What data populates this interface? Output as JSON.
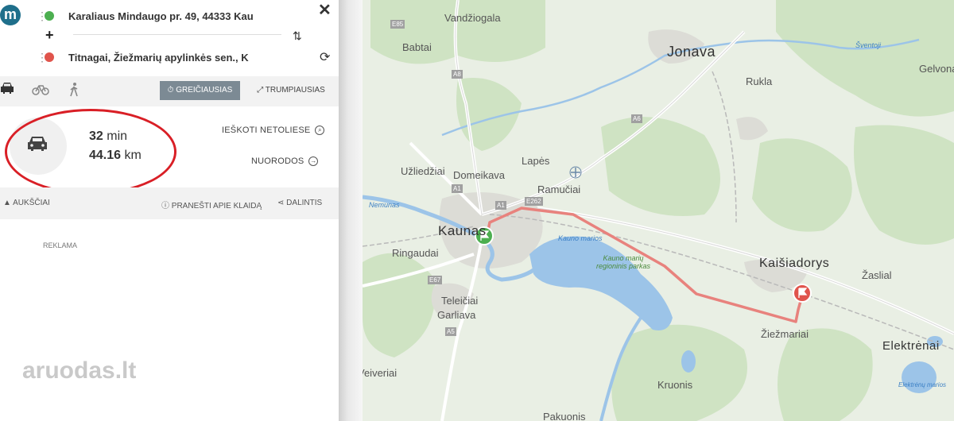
{
  "panel": {
    "logo_letter": "m",
    "origin": "Karaliaus Mindaugo pr. 49, 44333 Kau",
    "destination": "Titnagai, Žiežmarių apylinkės sen., K",
    "plus_label": "+",
    "close_label": "✕",
    "modes": [
      "car-icon",
      "bicycle-icon",
      "walk-icon"
    ],
    "fastest_label": "GREIČIAUSIAS",
    "shortest_label": "TRUMPIAUSIAS",
    "duration_value": "32",
    "duration_unit": "min",
    "distance_value": "44.16",
    "distance_unit": "km",
    "search_nearby": "IEŠKOTI NETOLIESE",
    "directions": "NUORODOS",
    "elevations": "AUKŠČIAI",
    "report_error": "PRANEŠTI APIE KLAIDĄ",
    "share": "DALINTIS",
    "ad_label": "REKLAMA",
    "watermark": "aruodas.lt"
  },
  "map": {
    "cities": [
      "Jonava",
      "Kaišiadorys",
      "Elektrėnai",
      "Kaunas"
    ],
    "towns": [
      "Vandžiogala",
      "Babtai",
      "Rukla",
      "Gelvonai",
      "Lapės",
      "Domeikava",
      "Užliedžiai",
      "Ramučiai",
      "Ringaudai",
      "Teleičiai",
      "Garliava",
      "Žaslial",
      "Žiežmariai",
      "Veiveriai",
      "Kruonis",
      "Pakuonis"
    ],
    "roads": [
      "E85",
      "A8",
      "A6",
      "A1",
      "E262",
      "A1",
      "E67",
      "A5"
    ],
    "water": [
      "Šventoji",
      "Nemunas",
      "Kauno marios",
      "Elektrėnų marios"
    ],
    "park": "Kauno marių regioninis parkas",
    "route_color": "#e8827d"
  }
}
